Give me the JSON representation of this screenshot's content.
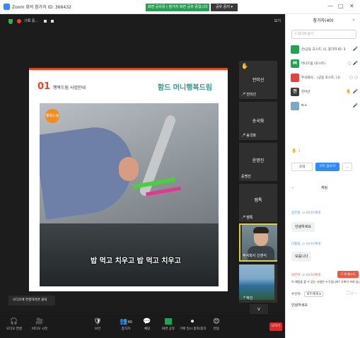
{
  "window": {
    "title": "Zoom 회의 참가자 ID: 366432",
    "recording_banner": "화면 공유중 | 참가자 화면 공유 중입니다",
    "stop_share_label": "공유 중지 ▾",
    "controls": [
      "—",
      "□",
      "✕"
    ]
  },
  "meeting": {
    "recording_label": "기록 중...",
    "view_label": "보기",
    "slide": {
      "number": "01",
      "subtitle": "행복드림 사업안내",
      "logo": "함드 머니행복드림",
      "badge": "행복드림",
      "caption": "밥 먹고 치우고 밥 먹고 치우고"
    },
    "tiles": [
      {
        "name": "전미선",
        "label": "전미선"
      },
      {
        "name": "송국화",
        "label": "송국화"
      },
      {
        "name": "윤명진",
        "label": "윤명진"
      },
      {
        "name": "캠톡",
        "label": "캠톡"
      },
      {
        "name": "",
        "label": "주식회사 신앤식"
      },
      {
        "name": "",
        "label": "박인"
      }
    ],
    "strip_scroll": "v",
    "tooltip": "오디오에 연결하려면 클릭"
  },
  "toolbar": {
    "items": [
      {
        "icon": "🎧",
        "label": "오디오 연결"
      },
      {
        "icon": "🎥",
        "label": "비디오 시작"
      },
      {
        "icon": "🛡",
        "label": "보안"
      },
      {
        "icon": "👥",
        "label": "참가자"
      },
      {
        "icon": "💬",
        "label": "채팅"
      },
      {
        "icon": "⬆",
        "label": "화면 공유"
      },
      {
        "icon": "⏺",
        "label": "기록 일시 중지/중지"
      },
      {
        "icon": "😊",
        "label": "반응"
      }
    ],
    "participants_count": "40",
    "leave_label": "나가기"
  },
  "panel": {
    "header": "참가자(40)",
    "search_placeholder": "참가자 찾기",
    "participants": [
      {
        "avatar": "",
        "avatar_color": "#21a354",
        "name": "은(공동 호스트, 나, 참가자 ID: 366432)",
        "status": "🎤"
      },
      {
        "avatar": "M",
        "avatar_color": "#21a354",
        "name": "머니드림 (호스트)",
        "status": "○ 🎤"
      },
      {
        "avatar": "",
        "avatar_color": "#e0463a",
        "name": "주식회사... (공동 호스트, 나)",
        "status": "○ ○"
      },
      {
        "avatar": "전",
        "avatar_color": "#3a3a3a",
        "name": "전미선",
        "status": "✋ 🎤"
      },
      {
        "avatar": "",
        "avatar_color": "#7fa6c6",
        "name": "N.S",
        "status": "🎤"
      }
    ],
    "reaction": "✋ 1",
    "invite_label": "초대",
    "mute_all_label": "모두 음소거",
    "more_label": "...",
    "chat_title": "채팅",
    "messages": [
      {
        "sender": "",
        "text": ""
      },
      {
        "sender": "김은희 -> 나(으)에게",
        "text": "안녕하세요"
      },
      {
        "sender": "다름림 -> 나(으)에게",
        "text": "모음니다"
      }
    ],
    "private_sender": "박은아 -> 나(으)에게",
    "new_message_badge": "1 새 메시지",
    "notice": "이 채팅을 볼 수 있는 사람은 누구입니까? 기록이 켜져 있습니다",
    "to_label": "수신자:",
    "to_value": "모두에게 ▾",
    "to_icons": "🗋 ○ ···",
    "input_text": "안녕하세요"
  },
  "colors": {
    "accent": "#2d8cff",
    "share_green": "#21a354",
    "leave_red": "#e02828",
    "slide_orange": "#e8431e"
  }
}
